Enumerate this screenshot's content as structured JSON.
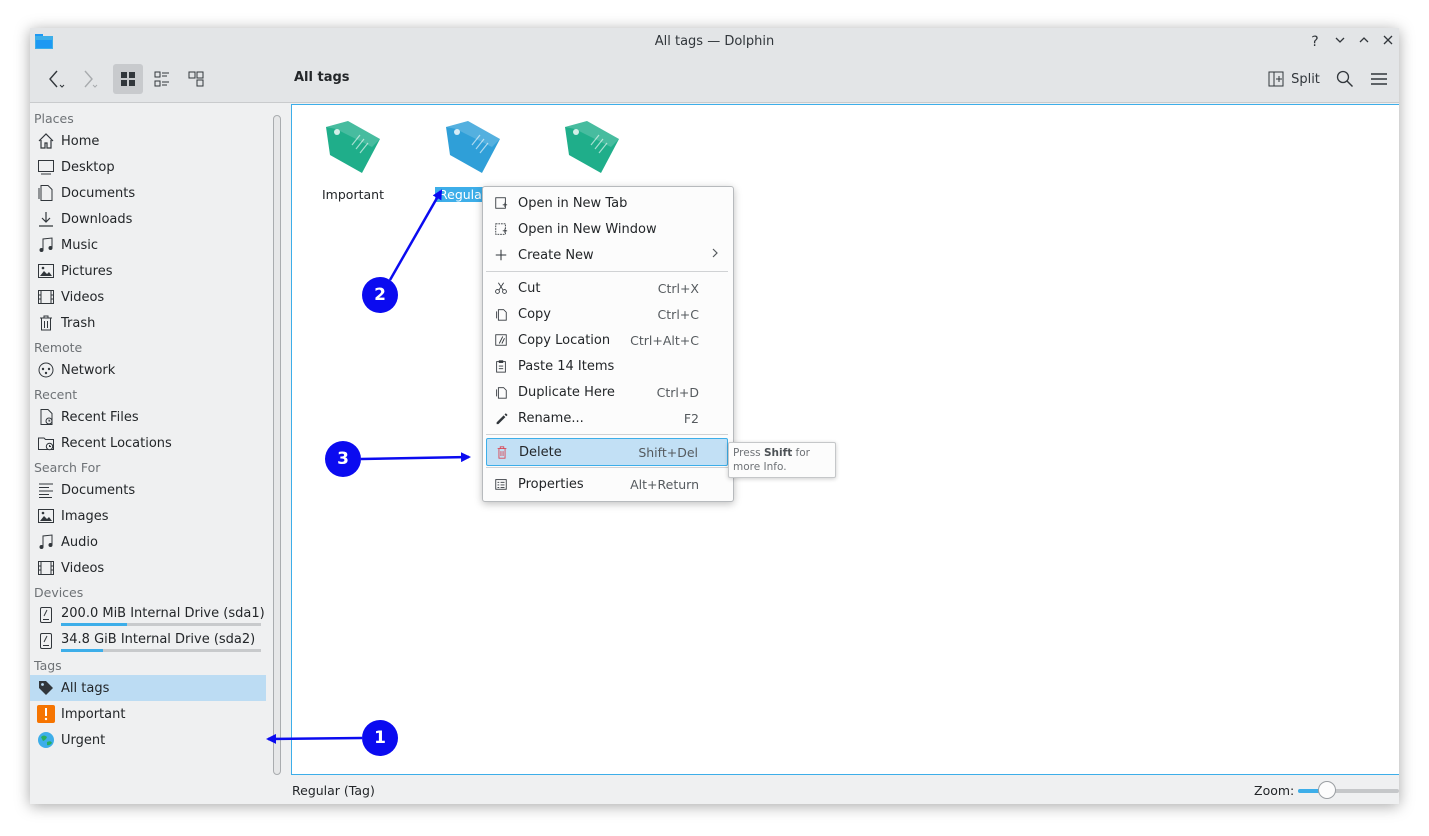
{
  "window": {
    "title": "All tags — Dolphin",
    "help": "?",
    "minimize": "⌄",
    "maximize": "⌃",
    "close": "✕"
  },
  "toolbar": {
    "location": "All tags",
    "split_label": "Split"
  },
  "sidebar": {
    "sections": [
      {
        "title": "Places",
        "items": [
          {
            "label": "Home",
            "icon": "home-icon"
          },
          {
            "label": "Desktop",
            "icon": "desktop-icon"
          },
          {
            "label": "Documents",
            "icon": "documents-icon"
          },
          {
            "label": "Downloads",
            "icon": "downloads-icon"
          },
          {
            "label": "Music",
            "icon": "music-icon"
          },
          {
            "label": "Pictures",
            "icon": "pictures-icon"
          },
          {
            "label": "Videos",
            "icon": "videos-icon"
          },
          {
            "label": "Trash",
            "icon": "trash-icon"
          }
        ]
      },
      {
        "title": "Remote",
        "items": [
          {
            "label": "Network",
            "icon": "network-icon"
          }
        ]
      },
      {
        "title": "Recent",
        "items": [
          {
            "label": "Recent Files",
            "icon": "recent-files-icon"
          },
          {
            "label": "Recent Locations",
            "icon": "recent-locations-icon"
          }
        ]
      },
      {
        "title": "Search For",
        "items": [
          {
            "label": "Documents",
            "icon": "search-documents-icon"
          },
          {
            "label": "Images",
            "icon": "images-icon"
          },
          {
            "label": "Audio",
            "icon": "audio-icon"
          },
          {
            "label": "Videos",
            "icon": "search-videos-icon"
          }
        ]
      },
      {
        "title": "Devices",
        "items": [
          {
            "label": "200.0 MiB Internal Drive (sda1)",
            "icon": "drive-icon",
            "usage": 0.33
          },
          {
            "label": "34.8 GiB Internal Drive (sda2)",
            "icon": "drive-icon",
            "usage": 0.21
          }
        ]
      },
      {
        "title": "Tags",
        "items": [
          {
            "label": "All tags",
            "icon": "tag-icon",
            "selected": true
          },
          {
            "label": "Important",
            "icon": "important-icon"
          },
          {
            "label": "Urgent",
            "icon": "urgent-icon"
          }
        ]
      }
    ]
  },
  "files": [
    {
      "name": "Important",
      "color": "#1fae8a"
    },
    {
      "name": "Regular",
      "color": "#2f9fd8",
      "selected": true
    },
    {
      "name": "",
      "color": "#1fae8a"
    }
  ],
  "context_menu": {
    "groups": [
      [
        {
          "label": "Open in New Tab",
          "icon": "open-new-tab-icon",
          "shortcut": ""
        },
        {
          "label": "Open in New Window",
          "icon": "open-new-window-icon",
          "shortcut": ""
        },
        {
          "label": "Create New",
          "icon": "plus-icon",
          "shortcut": "",
          "submenu": true
        }
      ],
      [
        {
          "label": "Cut",
          "icon": "cut-icon",
          "shortcut": "Ctrl+X"
        },
        {
          "label": "Copy",
          "icon": "copy-icon",
          "shortcut": "Ctrl+C"
        },
        {
          "label": "Copy Location",
          "icon": "copy-location-icon",
          "shortcut": "Ctrl+Alt+C"
        },
        {
          "label": "Paste 14 Items",
          "icon": "paste-icon",
          "shortcut": ""
        },
        {
          "label": "Duplicate Here",
          "icon": "duplicate-icon",
          "shortcut": "Ctrl+D"
        },
        {
          "label": "Rename...",
          "icon": "rename-icon",
          "shortcut": "F2"
        }
      ],
      [
        {
          "label": "Delete",
          "icon": "delete-icon",
          "shortcut": "Shift+Del",
          "highlighted": true
        }
      ],
      [
        {
          "label": "Properties",
          "icon": "properties-icon",
          "shortcut": "Alt+Return"
        }
      ]
    ]
  },
  "tooltip": {
    "prefix": "Press ",
    "key": "Shift",
    "suffix": " for more Info."
  },
  "status": {
    "text": "Regular (Tag)",
    "zoom_label": "Zoom:",
    "zoom_level": 0.28
  },
  "annotations": [
    {
      "number": "1"
    },
    {
      "number": "2"
    },
    {
      "number": "3"
    }
  ],
  "colors": {
    "accent": "#3daee9",
    "annotation": "#0b0bf0",
    "selection": "#bcdcf3",
    "delete_icon": "#da4453"
  }
}
